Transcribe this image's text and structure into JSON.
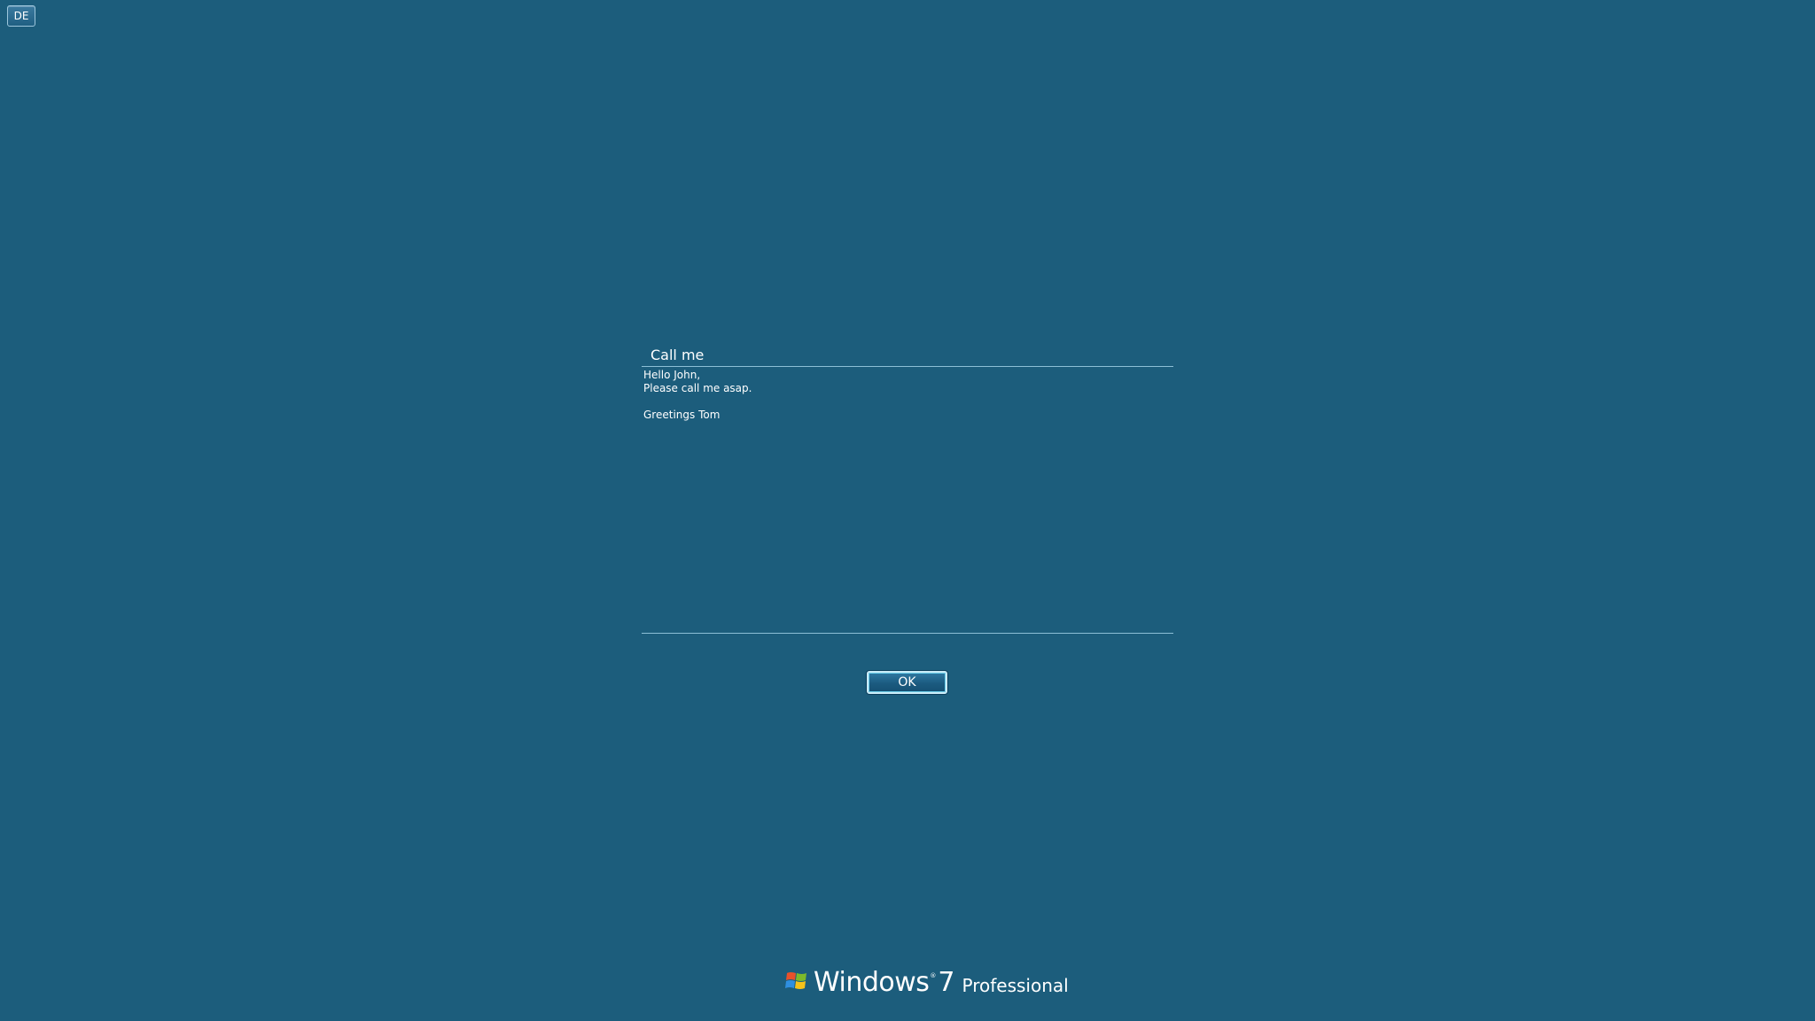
{
  "language_indicator": "DE",
  "message": {
    "title": "Call me",
    "body_lines": [
      "Hello John,",
      "Please call me asap.",
      "",
      "Greetings Tom"
    ]
  },
  "ok_button": "OK",
  "branding": {
    "product": "Windows",
    "trademark": "®",
    "version": "7",
    "edition": "Professional",
    "logo_icon": "windows-flag-icon"
  },
  "colors": {
    "background": "#1c5d7c",
    "rule": "#8cbfd6",
    "text": "#ffffff"
  }
}
